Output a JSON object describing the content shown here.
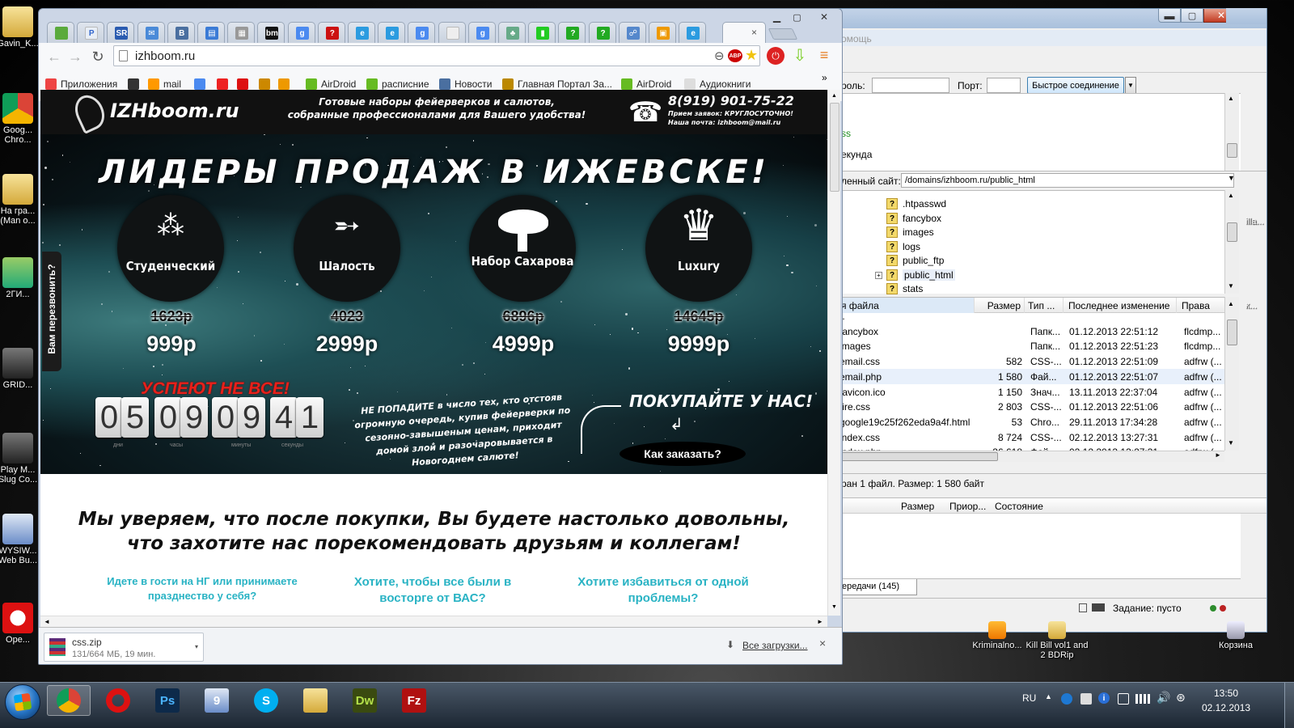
{
  "desktop": {
    "icons_left": [
      {
        "label": "Gavin_K...",
        "icon": "folder-icon"
      },
      {
        "label": "Goog... Chro...",
        "icon": "chrome-icon"
      },
      {
        "label": "На гра... (Man o...",
        "icon": "folder-icon"
      },
      {
        "label": "2ГИ...",
        "icon": "2gis-icon"
      },
      {
        "label": "GRID...",
        "icon": "game-icon"
      },
      {
        "label": "Play M... Slug Co...",
        "icon": "game-icon"
      },
      {
        "label": "WYSIW... Web Bu...",
        "icon": "wysiwyg-icon"
      },
      {
        "label": "Ope...",
        "icon": "opera-icon"
      }
    ],
    "icons_right": [
      {
        "label": "Kriminalno...",
        "icon": "video-icon"
      },
      {
        "label": "Kill Bill vol1 and 2 BDRip",
        "icon": "folder-icon"
      },
      {
        "label": "Корзина",
        "icon": "recycle-bin-icon"
      }
    ],
    "edge_labels": [
      "illa...",
      "к..."
    ]
  },
  "filezilla": {
    "menu_fragment": "омощь",
    "quickconnect": {
      "password_label": "роль:",
      "port_label": "Порт:",
      "connect_button": "Быстрое соединение"
    },
    "log_lines": [
      "",
      "ss",
      "екунда"
    ],
    "remote_site_label": "ленный сайт:",
    "remote_path": "/domains/izhboom.ru/public_html",
    "tree": [
      ".htpasswd",
      "fancybox",
      "images",
      "logs",
      "public_ftp",
      "public_html",
      "stats"
    ],
    "columns": {
      "name": "я файла",
      "size": "Размер",
      "type": "Тип ...",
      "modified": "Последнее изменение",
      "perms": "Права"
    },
    "files": [
      {
        "name": "..",
        "size": "",
        "type": "",
        "modified": "",
        "perms": ""
      },
      {
        "name": "fancybox",
        "size": "",
        "type": "Папк...",
        "modified": "01.12.2013 22:51:12",
        "perms": "flcdmp..."
      },
      {
        "name": "images",
        "size": "",
        "type": "Папк...",
        "modified": "01.12.2013 22:51:23",
        "perms": "flcdmp..."
      },
      {
        "name": "email.css",
        "size": "582",
        "type": "CSS-...",
        "modified": "01.12.2013 22:51:09",
        "perms": "adfrw (..."
      },
      {
        "name": "email.php",
        "size": "1 580",
        "type": "Фай...",
        "modified": "01.12.2013 22:51:07",
        "perms": "adfrw (..."
      },
      {
        "name": "favicon.ico",
        "size": "1 150",
        "type": "Знач...",
        "modified": "13.11.2013 22:37:04",
        "perms": "adfrw (..."
      },
      {
        "name": "fire.css",
        "size": "2 803",
        "type": "CSS-...",
        "modified": "01.12.2013 22:51:06",
        "perms": "adfrw (..."
      },
      {
        "name": "google19c25f262eda9a4f.html",
        "size": "53",
        "type": "Chro...",
        "modified": "29.11.2013 17:34:28",
        "perms": "adfrw (..."
      },
      {
        "name": "index.css",
        "size": "8 724",
        "type": "CSS-...",
        "modified": "02.12.2013 13:27:31",
        "perms": "adfrw (..."
      },
      {
        "name": "index.php",
        "size": "36 618",
        "type": "Фай...",
        "modified": "02.12.2013 13:27:31",
        "perms": "adfrw (..."
      }
    ],
    "status": "ран 1 файл. Размер: 1 580 байт",
    "queue_columns": {
      "size": "Размер",
      "priority": "Приор...",
      "state": "Состояние"
    },
    "queue_tab": "ередачи (145)",
    "task": "Задание: пусто"
  },
  "chrome": {
    "url": "izhboom.ru",
    "tabs": [
      {
        "icon": "leaf-icon",
        "color": "#5aaa3c",
        "text": ""
      },
      {
        "icon": "pl-icon",
        "color": "#e8eef6",
        "text": "P"
      },
      {
        "icon": "sr-icon",
        "color": "#2a5bb0",
        "text": "SR"
      },
      {
        "icon": "mail-icon",
        "color": "#4a8ad8",
        "text": "✉"
      },
      {
        "icon": "vk-icon",
        "color": "#4a6fa0",
        "text": "В"
      },
      {
        "icon": "chat-icon",
        "color": "#3b7bd6",
        "text": "▤"
      },
      {
        "icon": "grid-icon",
        "color": "#999",
        "text": "▦"
      },
      {
        "icon": "bm-icon",
        "color": "#111",
        "text": "bm"
      },
      {
        "icon": "google-icon",
        "color": "#4b8af0",
        "text": "g"
      },
      {
        "icon": "question-red-icon",
        "color": "#c11",
        "text": "?"
      },
      {
        "icon": "ie-icon",
        "color": "#2b9be0",
        "text": "e"
      },
      {
        "icon": "ie-icon",
        "color": "#2b9be0",
        "text": "e"
      },
      {
        "icon": "google-icon",
        "color": "#4b8af0",
        "text": "g"
      },
      {
        "icon": "page-icon",
        "color": "#eee",
        "text": ""
      },
      {
        "icon": "google-icon",
        "color": "#4b8af0",
        "text": "g"
      },
      {
        "icon": "tree-icon",
        "color": "#6a8",
        "text": "♣"
      },
      {
        "icon": "app-icon",
        "color": "#2c2",
        "text": "▮"
      },
      {
        "icon": "question-green-icon",
        "color": "#2a2",
        "text": "?"
      },
      {
        "icon": "question-green-icon",
        "color": "#2a2",
        "text": "?"
      },
      {
        "icon": "network-icon",
        "color": "#58c",
        "text": "☍"
      },
      {
        "icon": "photo-icon",
        "color": "#e90",
        "text": "▣"
      },
      {
        "icon": "ie-icon",
        "color": "#2b9be0",
        "text": "e"
      }
    ],
    "bookmarks": [
      {
        "label": "Приложения",
        "icon": "apps-icon",
        "color": "#e44"
      },
      {
        "label": "",
        "icon": "game-pad-icon",
        "color": "#333"
      },
      {
        "label": "mail",
        "icon": "mail-at-icon",
        "color": "#f90"
      },
      {
        "label": "",
        "icon": "google-icon",
        "color": "#4b8af0"
      },
      {
        "label": "",
        "icon": "yandex-icon",
        "color": "#e22"
      },
      {
        "label": "",
        "icon": "youtube-icon",
        "color": "#d11"
      },
      {
        "label": "",
        "icon": "avito-icon",
        "color": "#c80"
      },
      {
        "label": "",
        "icon": "puzzle-icon",
        "color": "#e90"
      },
      {
        "label": "AirDroid",
        "icon": "airdroid-icon",
        "color": "#6b2"
      },
      {
        "label": "расписние",
        "icon": "airdroid-icon",
        "color": "#6b2"
      },
      {
        "label": "Новости",
        "icon": "vk-icon",
        "color": "#4a6fa0"
      },
      {
        "label": "Главная Портал За...",
        "icon": "emblem-icon",
        "color": "#b80"
      },
      {
        "label": "AirDroid",
        "icon": "airdroid-icon",
        "color": "#6b2"
      },
      {
        "label": "Аудиокниги",
        "icon": "page-icon",
        "color": "#ddd"
      }
    ],
    "download": {
      "name": "css.zip",
      "progress": "131/664 МБ, 19 мин.",
      "all": "Все загрузки..."
    }
  },
  "site": {
    "logo": "IZHboom.ru",
    "tagline1": "Готовые наборы фейерверков и салютов,",
    "tagline2": "собранные профессионалами для Вашего удобства!",
    "phone": "8(919) 901-75-22",
    "phone_note1": "Прием заявок: КРУГЛОСУТОЧНО!",
    "phone_note2": "Наша почта: izhboom@mail.ru",
    "headline": "ЛИДЕРЫ ПРОДАЖ В ИЖЕВСКЕ!",
    "side_tab": "Вам перезвонить?",
    "products": [
      {
        "name": "Студенческий",
        "old": "1623р",
        "new": "999р",
        "icon": "sparkler-icon"
      },
      {
        "name": "Шалость",
        "old": "4023",
        "new": "2999р",
        "icon": "firework-rocket-icon"
      },
      {
        "name": "Набор Сахарова",
        "old": "6896р",
        "new": "4999р",
        "icon": "mushroom-cloud-icon"
      },
      {
        "name": "Luxury",
        "old": "14645р",
        "new": "9999р",
        "icon": "crown-icon"
      }
    ],
    "hurry": "УСПЕЮТ НЕ ВСЕ!",
    "timer": {
      "digits": [
        "0",
        "5",
        "0",
        "9",
        "0",
        "9",
        "4",
        "1"
      ],
      "units": [
        "дни",
        "часы",
        "минуты",
        "секунды"
      ]
    },
    "pitch": "НЕ ПОПАДИТЕ в число тех, кто отстояв огромную очередь, купив фейерверки по сезонно-завышеным ценам, приходит домой злой и разочаровывается в Новогоднем салюте!",
    "buy": "ПОКУПАЙТЕ У НАС!",
    "order": "Как заказать?",
    "assure1": "Мы уверяем, что после покупки, Вы будете настолько довольны,",
    "assure2": "что захотите нас порекомендовать друзьям и коллегам!",
    "q1a": "Идете в гости на НГ или принимаете",
    "q1b": "празднество у себя?",
    "q2a": "Хотите, чтобы все были  в",
    "q2b": "восторге от ВАС?",
    "q3a": "Хотите избавиться от одной",
    "q3b": "проблемы?"
  },
  "taskbar": {
    "apps": [
      "chrome-icon",
      "opera-icon",
      "photoshop-icon",
      "wysiwyg-icon",
      "skype-icon",
      "explorer-icon",
      "dreamweaver-icon",
      "filezilla-icon"
    ],
    "lang": "RU",
    "time": "13:50",
    "date": "02.12.2013"
  },
  "colors": {
    "teal": "#29b3c4",
    "red": "#e8201a",
    "nav": "#0c0c0c"
  }
}
